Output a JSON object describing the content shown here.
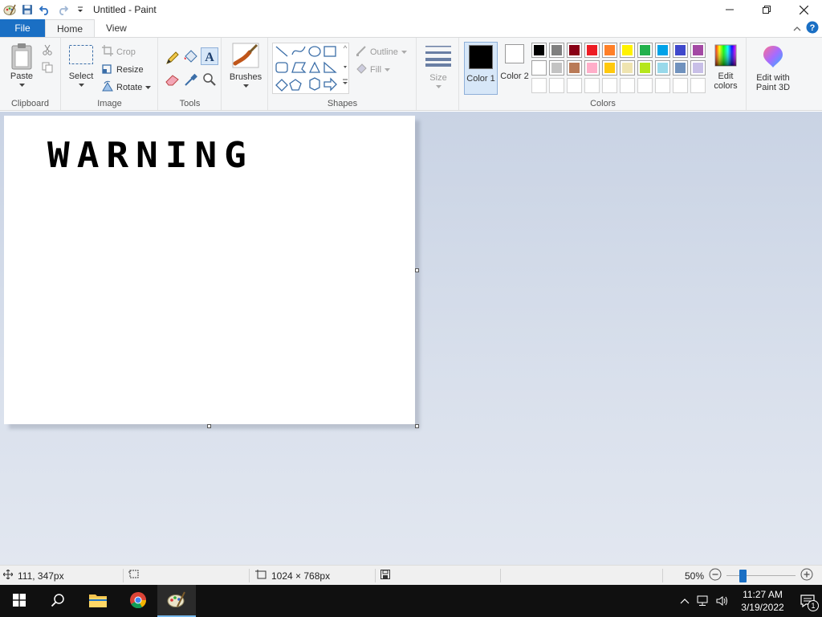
{
  "window": {
    "title": "Untitled - Paint",
    "controls": [
      "minimize",
      "maximize",
      "close"
    ]
  },
  "tabs": {
    "file": "File",
    "home": "Home",
    "view": "View"
  },
  "ribbon": {
    "clipboard": {
      "label": "Clipboard",
      "paste": "Paste"
    },
    "image": {
      "label": "Image",
      "select": "Select",
      "crop": "Crop",
      "resize": "Resize",
      "rotate": "Rotate"
    },
    "tools": {
      "label": "Tools"
    },
    "brushes": {
      "label": "Brushes"
    },
    "shapes": {
      "label": "Shapes",
      "outline": "Outline",
      "fill": "Fill"
    },
    "size": {
      "label": "Size"
    },
    "colors": {
      "label": "Colors",
      "color1": "Color 1",
      "color2": "Color 2",
      "edit_colors": "Edit colors",
      "edit_paint3d": "Edit with Paint 3D",
      "color1_value": "#000000",
      "color2_value": "#ffffff",
      "palette_row1": [
        "#000000",
        "#7f7f7f",
        "#880015",
        "#ed1c24",
        "#ff7f27",
        "#fff200",
        "#22b14c",
        "#00a2e8",
        "#3f48cc",
        "#a349a4"
      ],
      "palette_row2": [
        "#ffffff",
        "#c3c3c3",
        "#b97a57",
        "#ffaec9",
        "#ffc90e",
        "#efe4b0",
        "#b5e61d",
        "#99d9ea",
        "#7092be",
        "#c8bfe7"
      ]
    }
  },
  "canvas": {
    "text": "WARNING"
  },
  "statusbar": {
    "cursor_pos": "111, 347px",
    "image_size": "1024 × 768px",
    "zoom": "50%"
  },
  "taskbar": {
    "time": "11:27 AM",
    "date": "3/19/2022",
    "notification_count": "1"
  }
}
